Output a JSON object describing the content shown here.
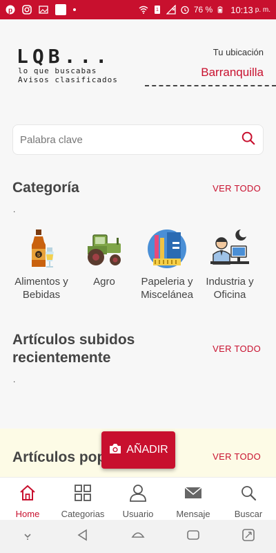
{
  "statusbar": {
    "battery": "76 %",
    "time": "10:13",
    "ampm": "p. m."
  },
  "brand": {
    "logo": "LQB...",
    "tagline1": "lo que buscabas",
    "tagline2": "Avisos clasificados"
  },
  "location": {
    "label": "Tu ubicación",
    "city": "Barranquilla"
  },
  "search": {
    "placeholder": "Palabra clave"
  },
  "categories": {
    "title": "Categoría",
    "see_all": "VER TODO",
    "dot": ".",
    "items": [
      {
        "line1": "Alimentos y",
        "line2": "Bebidas",
        "icon": "bottles-icon"
      },
      {
        "line1": "Agro",
        "line2": "",
        "icon": "tractor-icon"
      },
      {
        "line1": "Papeleria y",
        "line2": "Miscelánea",
        "icon": "stationery-icon"
      },
      {
        "line1": "Industria y",
        "line2": "Oficina",
        "icon": "office-worker-icon"
      }
    ]
  },
  "recent": {
    "title_line1": "Artículos subidos",
    "title_line2": "recientemente",
    "see_all": "VER TODO",
    "dot": "."
  },
  "popular": {
    "title": "Artículos pop",
    "see_all": "VER TODO"
  },
  "add_button": {
    "label": "AÑADIR"
  },
  "bottom_nav": {
    "items": [
      {
        "label": "Home",
        "icon": "home-icon",
        "active": true
      },
      {
        "label": "Categorias",
        "icon": "grid-icon"
      },
      {
        "label": "Usuario",
        "icon": "user-icon"
      },
      {
        "label": "Mensaje",
        "icon": "mail-icon"
      },
      {
        "label": "Buscar",
        "icon": "search-icon"
      }
    ]
  },
  "colors": {
    "accent": "#c8102e",
    "background": "#f7f7f7",
    "popular_band": "#fdfbe6"
  }
}
